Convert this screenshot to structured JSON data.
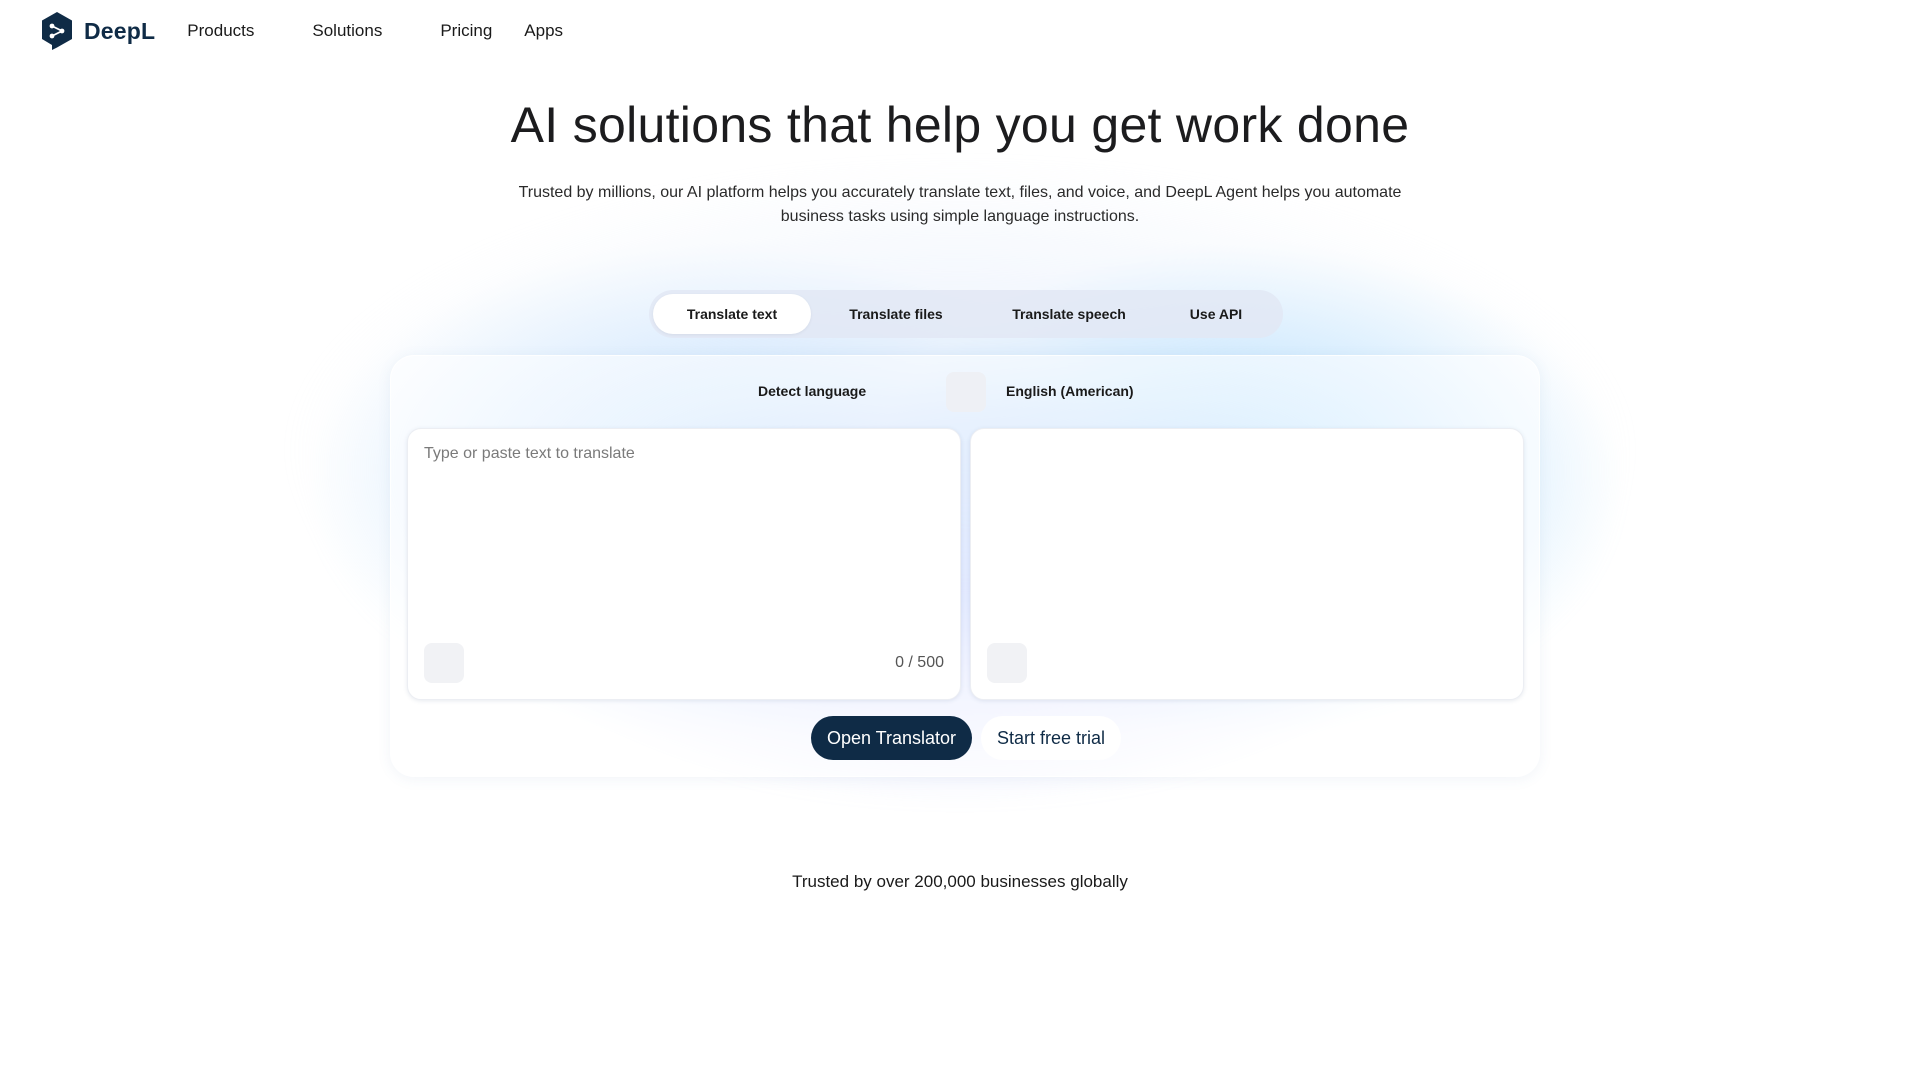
{
  "header": {
    "brand": "DeepL",
    "nav": [
      "Products",
      "Solutions",
      "Pricing",
      "Apps"
    ]
  },
  "hero": {
    "title": "AI solutions that help you get work done",
    "subtitle": "Trusted by millions, our AI platform helps you accurately translate text, files, and voice, and DeepL Agent helps you automate business tasks using simple language instructions."
  },
  "tabs": [
    {
      "label": "Translate text",
      "active": true
    },
    {
      "label": "Translate files",
      "active": false
    },
    {
      "label": "Translate speech",
      "active": false
    },
    {
      "label": "Use API",
      "active": false
    }
  ],
  "translator": {
    "source_language": "Detect language",
    "target_language": "English (American)",
    "source_placeholder": "Type or paste text to translate",
    "source_value": "",
    "char_counter": "0 / 500"
  },
  "actions": {
    "primary": "Open Translator",
    "secondary": "Start free trial"
  },
  "trusted_text": "Trusted by over 200,000 businesses globally",
  "colors": {
    "brand_navy": "#0f2b46",
    "tab_bar": "#e2e8f4"
  },
  "icons": [
    "deepl-logo-icon",
    "swap-languages-icon",
    "microphone-icon",
    "copy-icon"
  ]
}
